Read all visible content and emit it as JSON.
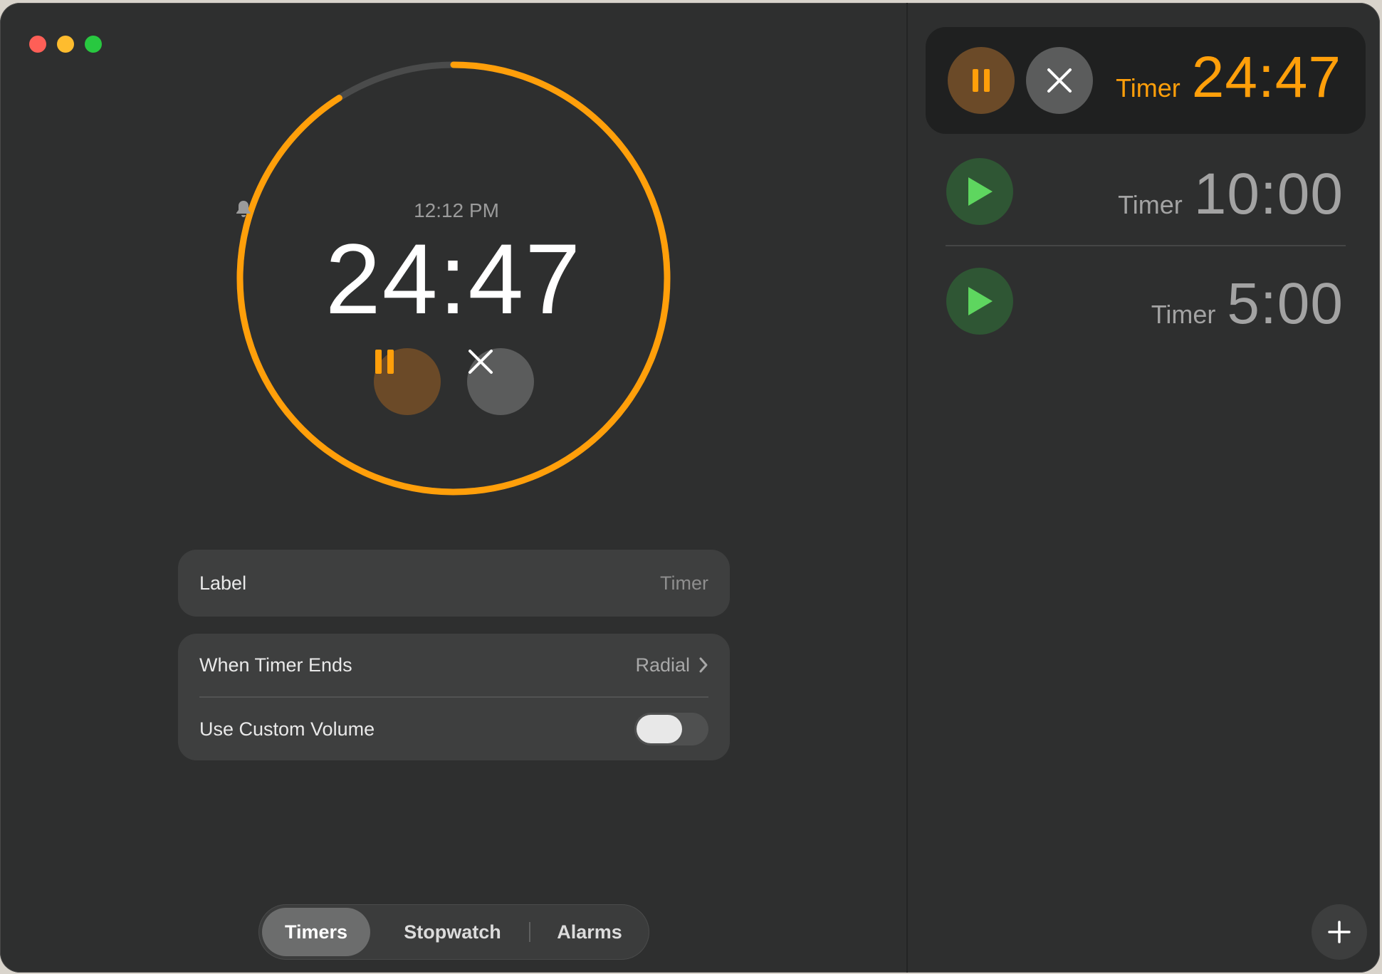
{
  "window": {
    "controls": [
      "close",
      "minimize",
      "zoom"
    ]
  },
  "main_timer": {
    "alarm_time": "12:12 PM",
    "remaining": "24:47",
    "progress_remaining_fraction": 0.91,
    "pause_icon": "pause-icon",
    "cancel_icon": "close-icon"
  },
  "settings": {
    "label": {
      "title": "Label",
      "value": "Timer"
    },
    "when_ends": {
      "title": "When Timer Ends",
      "value": "Radial"
    },
    "custom_volume": {
      "title": "Use Custom Volume",
      "enabled": false
    }
  },
  "tabs": [
    {
      "label": "Timers",
      "active": true
    },
    {
      "label": "Stopwatch",
      "active": false
    },
    {
      "label": "Alarms",
      "active": false
    }
  ],
  "timers_list": [
    {
      "label": "Timer",
      "time": "24:47",
      "state": "running"
    },
    {
      "label": "Timer",
      "time": "10:00",
      "state": "idle"
    },
    {
      "label": "Timer",
      "time": "5:00",
      "state": "idle"
    }
  ],
  "colors": {
    "accent_orange": "#ff9f0a",
    "play_green": "#5ed65f",
    "background": "#2e2f2f"
  },
  "add_button_icon": "plus-icon"
}
